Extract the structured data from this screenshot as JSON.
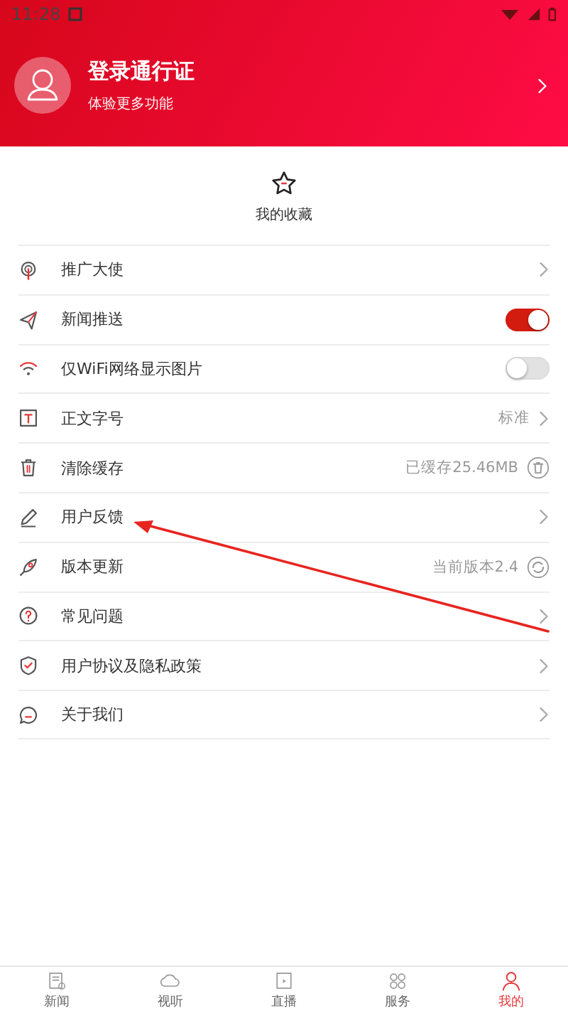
{
  "status_bar": {
    "time": "11:28"
  },
  "profile": {
    "title": "登录通行证",
    "subtitle": "体验更多功能"
  },
  "favorites": {
    "label": "我的收藏"
  },
  "settings": [
    {
      "kind": "link",
      "label": "推广大使"
    },
    {
      "kind": "toggle",
      "label": "新闻推送",
      "on": true
    },
    {
      "kind": "toggle",
      "label": "仅WiFi网络显示图片",
      "on": false
    },
    {
      "kind": "link",
      "label": "正文字号",
      "value": "标准"
    },
    {
      "kind": "action",
      "label": "清除缓存",
      "value": "已缓存25.46MB"
    },
    {
      "kind": "link",
      "label": "用户反馈"
    },
    {
      "kind": "action",
      "label": "版本更新",
      "value": "当前版本2.4"
    },
    {
      "kind": "link",
      "label": "常见问题"
    },
    {
      "kind": "link",
      "label": "用户协议及隐私政策"
    },
    {
      "kind": "link",
      "label": "关于我们"
    }
  ],
  "tab_bar": [
    {
      "label": "新闻",
      "selected": false
    },
    {
      "label": "视听",
      "selected": false
    },
    {
      "label": "直播",
      "selected": false
    },
    {
      "label": "服务",
      "selected": false
    },
    {
      "label": "我的",
      "selected": true
    }
  ]
}
